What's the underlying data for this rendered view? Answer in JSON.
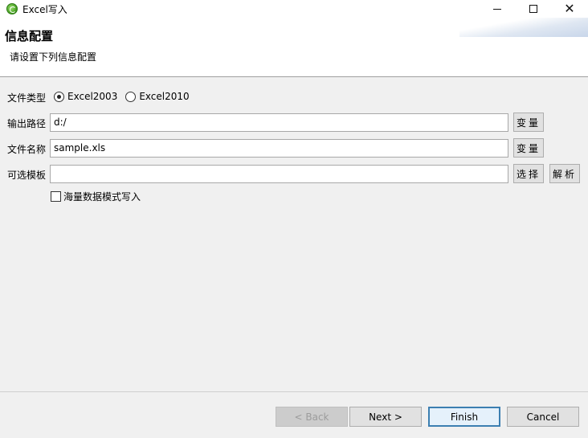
{
  "window": {
    "title": "Excel写入",
    "controls": {
      "minimize_icon": "minimize-icon",
      "maximize_icon": "maximize-icon",
      "close_icon": "close-icon"
    }
  },
  "header": {
    "title": "信息配置",
    "description": "请设置下列信息配置"
  },
  "form": {
    "file_type": {
      "label": "文件类型",
      "options": [
        {
          "label": "Excel2003",
          "checked": true
        },
        {
          "label": "Excel2010",
          "checked": false
        }
      ]
    },
    "output_path": {
      "label": "输出路径",
      "value": "d:/",
      "button": "变量"
    },
    "file_name": {
      "label": "文件名称",
      "value": "sample.xls",
      "button": "变量"
    },
    "template": {
      "label": "可选模板",
      "value": "",
      "select_button": "选择",
      "parse_button": "解析"
    },
    "mass_data": {
      "label": "海量数据模式写入",
      "checked": false
    }
  },
  "footer": {
    "back": "< Back",
    "next": "Next >",
    "finish": "Finish",
    "cancel": "Cancel"
  }
}
